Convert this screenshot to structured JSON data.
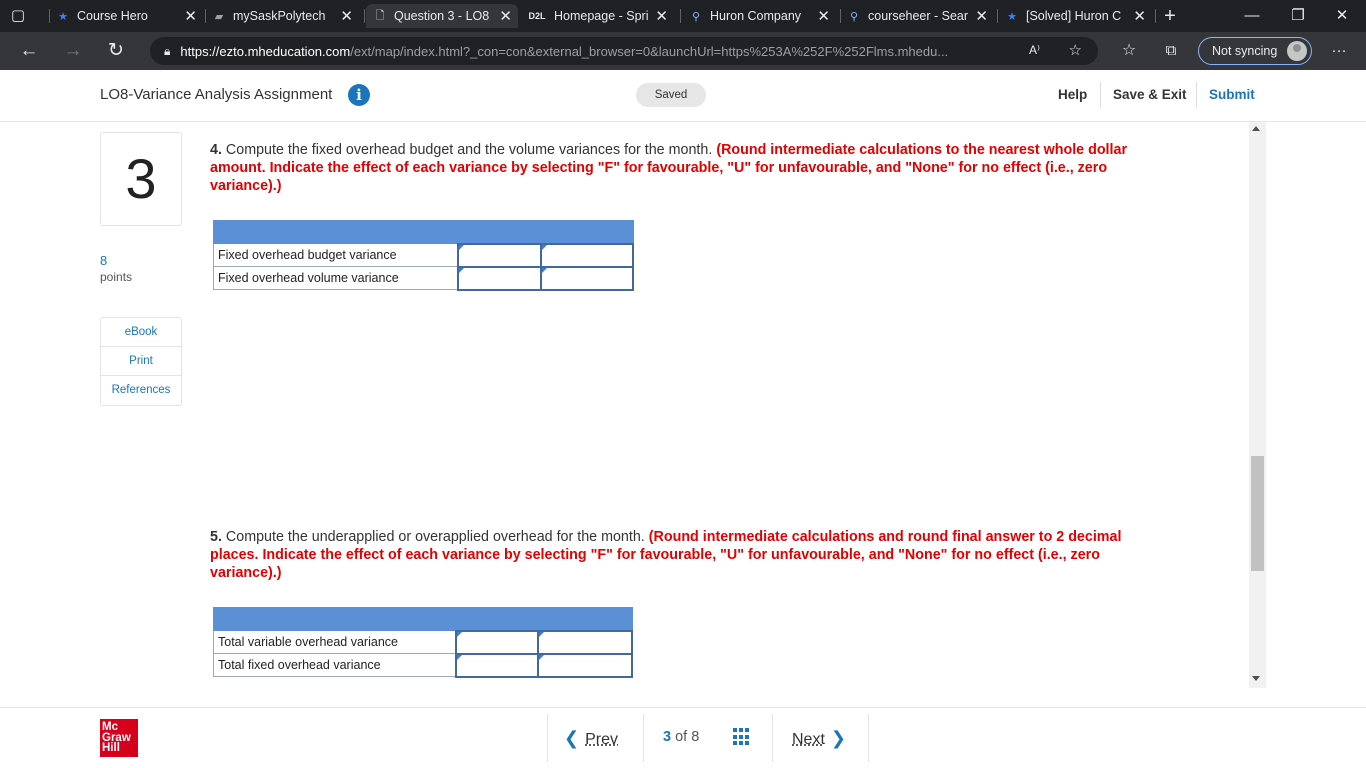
{
  "browser": {
    "tabs": [
      {
        "title": "Course Hero",
        "icon": "star-icon"
      },
      {
        "title": "mySaskPolytech",
        "icon": "flag-icon"
      },
      {
        "title": "Question 3 - LO8",
        "icon": "document-icon"
      },
      {
        "title": "Homepage - Spri",
        "icon": "d2l-icon"
      },
      {
        "title": "Huron Company",
        "icon": "search-icon"
      },
      {
        "title": "courseheer - Sear",
        "icon": "search-icon"
      },
      {
        "title": "[Solved] Huron C",
        "icon": "star-icon"
      }
    ],
    "url_host": "https://ezto.mheducation.com",
    "url_rest": "/ext/map/index.html?_con=con&external_browser=0&launchUrl=https%253A%252F%252Flms.mhedu...",
    "sync_label": "Not syncing"
  },
  "header": {
    "assignment_title": "LO8-Variance Analysis Assignment",
    "saved_label": "Saved",
    "help_label": "Help",
    "save_exit_label": "Save & Exit",
    "submit_label": "Submit"
  },
  "sidebar": {
    "question_number": "3",
    "points_value": "8",
    "points_label": "points",
    "links": [
      "eBook",
      "Print",
      "References"
    ]
  },
  "questions": [
    {
      "number": "4.",
      "text": "Compute the fixed overhead budget and the volume variances for the month.",
      "instruction": "(Round intermediate calculations to the nearest whole dollar amount. Indicate the effect of each variance by selecting \"F\" for favourable, \"U\" for unfavourable, and \"None\" for no effect (i.e., zero variance).)",
      "rows": [
        "Fixed overhead budget variance",
        "Fixed overhead volume variance"
      ]
    },
    {
      "number": "5.",
      "text": "Compute the underapplied or overapplied overhead for the month.",
      "instruction": "(Round intermediate calculations and round final answer to 2 decimal places. Indicate the effect of each variance by selecting \"F\" for favourable, \"U\" for unfavourable, and \"None\" for no effect (i.e., zero variance).)",
      "rows": [
        "Total variable overhead variance",
        "Total fixed overhead variance"
      ]
    }
  ],
  "footer": {
    "logo_line1": "Mc",
    "logo_line2": "Graw",
    "logo_line3": "Hill",
    "prev_label": "Prev",
    "current_page": "3",
    "of_label": "of",
    "total_pages": "8",
    "next_label": "Next"
  },
  "colors": {
    "accent": "#1b75bc",
    "instruction_red": "#e20000",
    "table_header": "#5c90d6",
    "brand_red": "#d6001c"
  }
}
